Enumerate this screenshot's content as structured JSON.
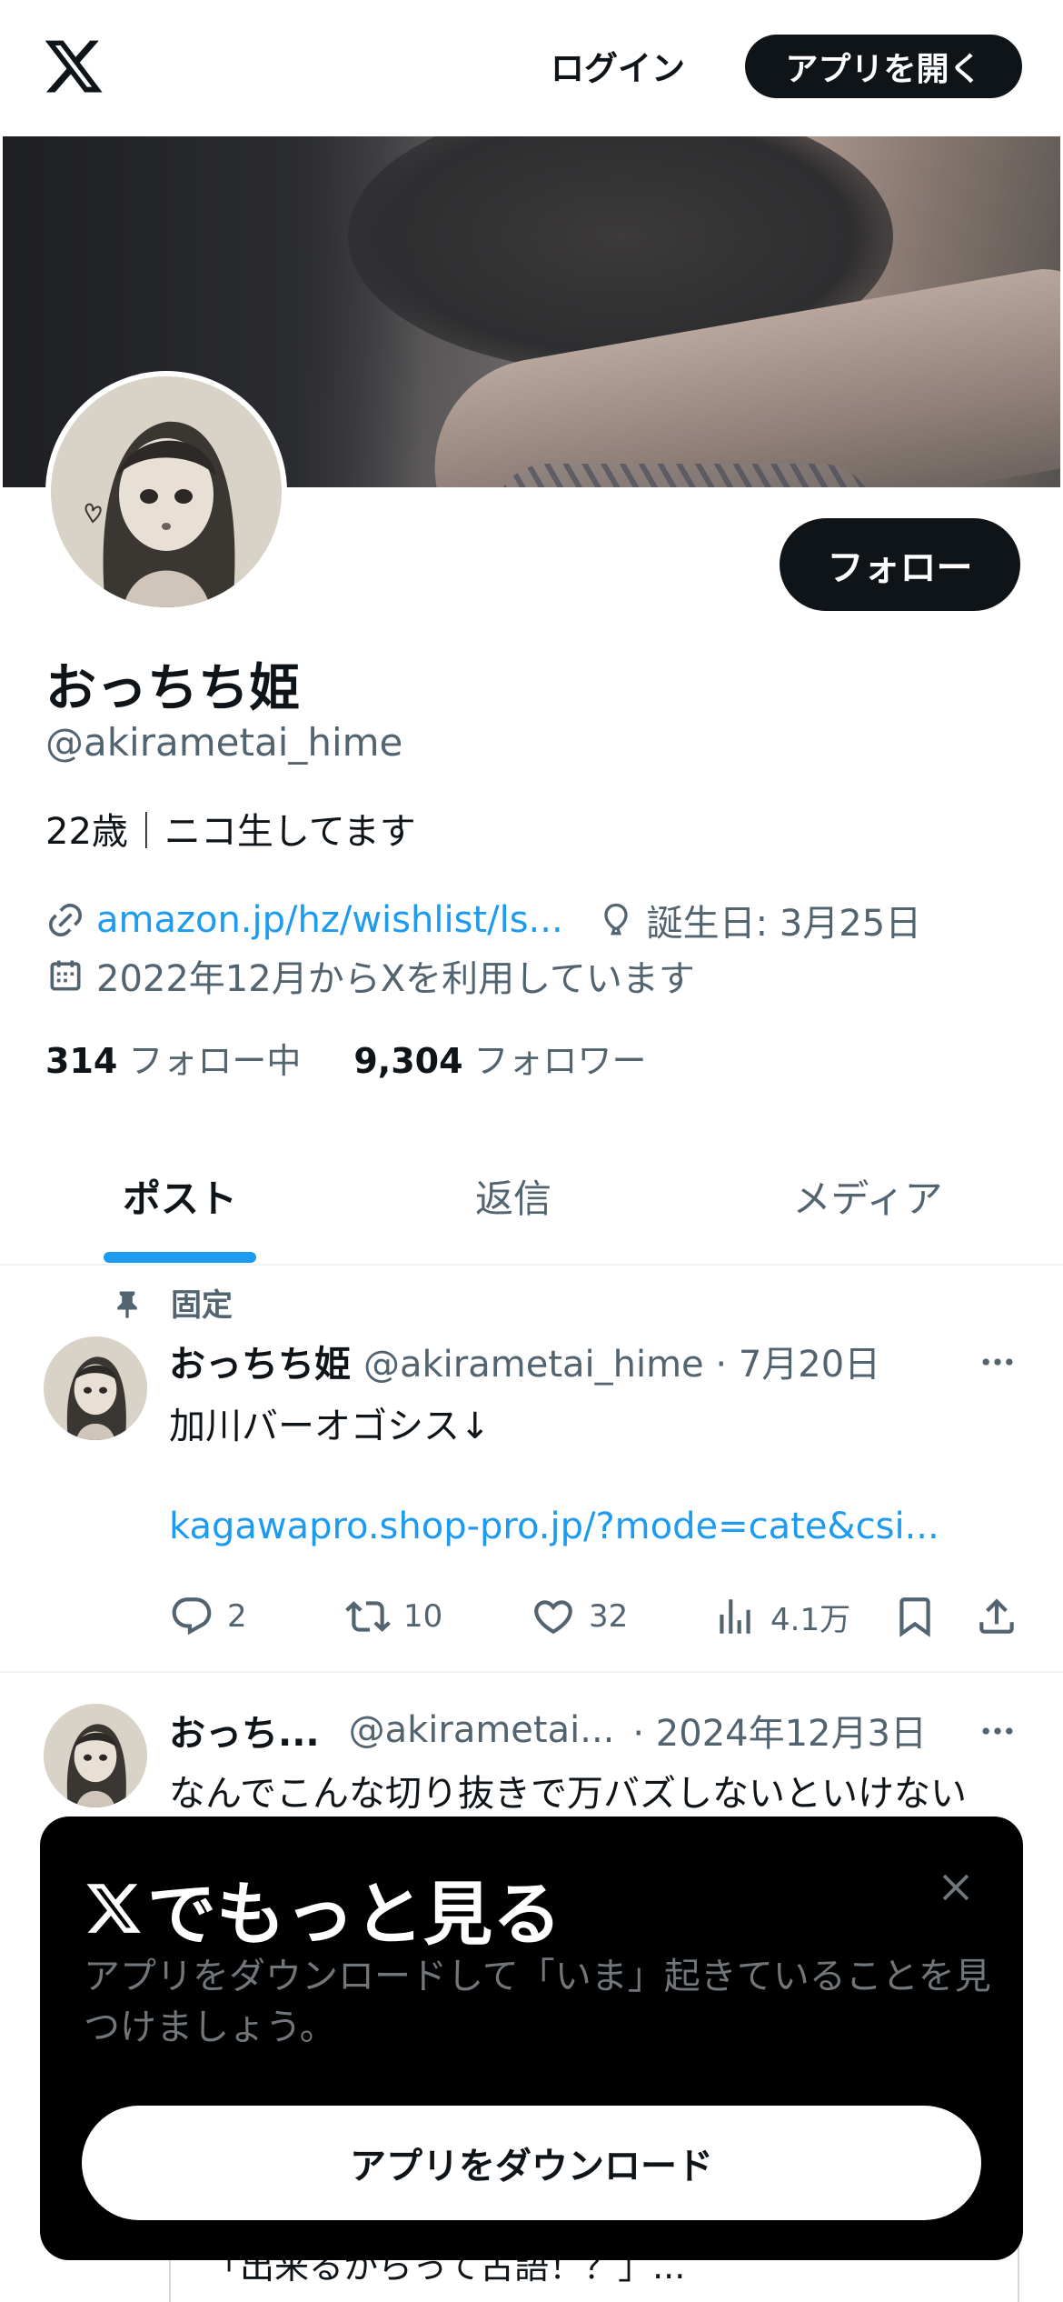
{
  "topbar": {
    "login_label": "ログイン",
    "open_app_label": "アプリを開く"
  },
  "profile": {
    "display_name": "おっちち姫",
    "handle": "@akirametai_hime",
    "bio": "22歳｜ニコ生してます",
    "link": "amazon.jp/hz/wishlist/ls...",
    "birthday": "誕生日: 3月25日",
    "joined": "2022年12月からXを利用しています",
    "following_count": "314",
    "following_label": "フォロー中",
    "followers_count": "9,304",
    "followers_label": "フォロワー",
    "follow_button": "フォロー"
  },
  "tabs": [
    {
      "label": "ポスト",
      "active": true
    },
    {
      "label": "返信",
      "active": false
    },
    {
      "label": "メディア",
      "active": false
    }
  ],
  "posts": [
    {
      "pinned_label": "固定",
      "name": "おっちち姫",
      "handle_date": "@akirametai_hime · 7月20日",
      "text": "加川バーオゴシス↓",
      "link": "kagawapro.shop-pro.jp/?mode=cate&csi...",
      "replies": "2",
      "reposts": "10",
      "likes": "32",
      "views": "4.1万"
    },
    {
      "name": "おっち...",
      "handle": "@akirametai...",
      "date": "· 2024年12月3日",
      "text": "なんでこんな切り抜きで万バズしないといけない",
      "quote_peek": "「出来るからって古語！？」..."
    }
  ],
  "modal": {
    "title": "でもっと見る",
    "description": "アプリをダウンロードして「いま」起きていることを見つけましょう。",
    "button": "アプリをダウンロード"
  },
  "colors": {
    "accent": "#1d9bf0",
    "text_primary": "#0f1419",
    "text_secondary": "#536471",
    "button_dark": "#0f1419"
  },
  "icons": [
    "x-logo-icon",
    "link-icon",
    "balloon-icon",
    "calendar-icon",
    "pin-icon",
    "more-icon",
    "reply-icon",
    "repost-icon",
    "like-icon",
    "views-icon",
    "bookmark-icon",
    "share-icon",
    "close-icon"
  ]
}
